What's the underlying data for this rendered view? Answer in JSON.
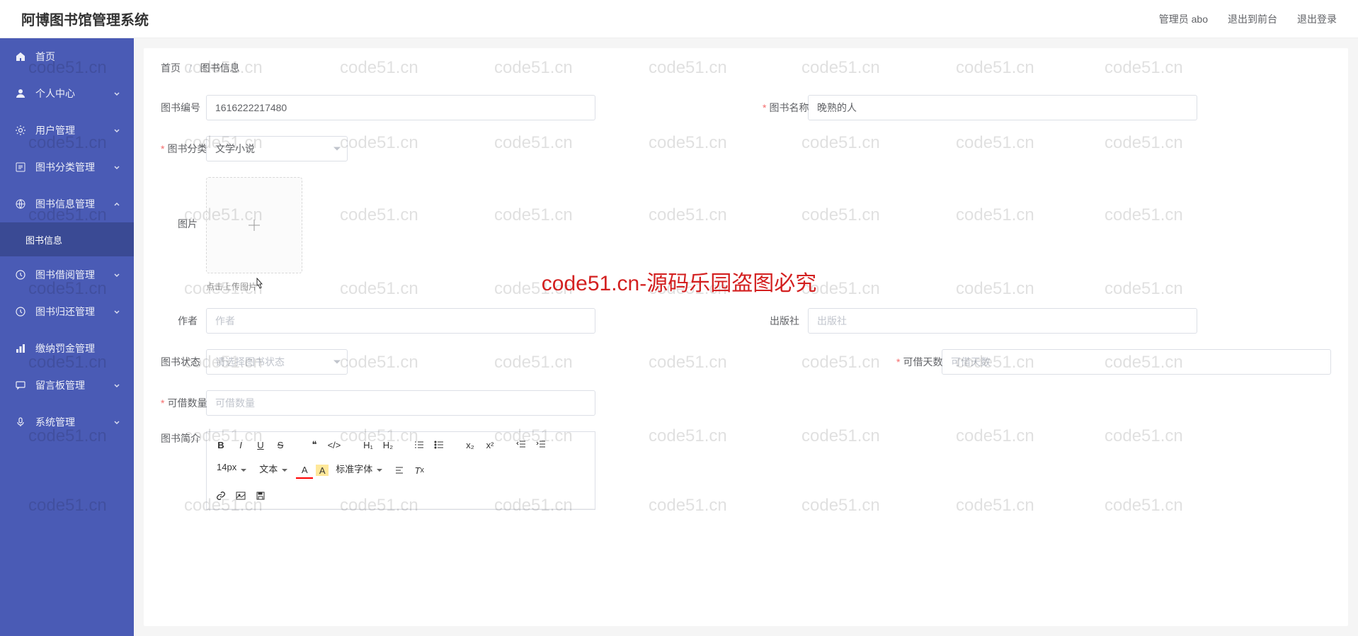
{
  "header": {
    "logo": "阿博图书馆管理系统",
    "admin": "管理员 abo",
    "exit_front": "退出到前台",
    "logout": "退出登录"
  },
  "sidebar": {
    "items": [
      {
        "label": "首页",
        "icon": "home"
      },
      {
        "label": "个人中心",
        "icon": "user",
        "arrow": true
      },
      {
        "label": "用户管理",
        "icon": "gear",
        "arrow": true
      },
      {
        "label": "图书分类管理",
        "icon": "list",
        "arrow": true
      },
      {
        "label": "图书信息管理",
        "icon": "globe",
        "arrow": true,
        "open": true,
        "sub": [
          {
            "label": "图书信息"
          }
        ]
      },
      {
        "label": "图书借阅管理",
        "icon": "clock",
        "arrow": true
      },
      {
        "label": "图书归还管理",
        "icon": "clock",
        "arrow": true
      },
      {
        "label": "缴纳罚金管理",
        "icon": "bar"
      },
      {
        "label": "留言板管理",
        "icon": "chat",
        "arrow": true
      },
      {
        "label": "系统管理",
        "icon": "mic",
        "arrow": true
      }
    ]
  },
  "breadcrumb": {
    "home": "首页",
    "current": "图书信息"
  },
  "form": {
    "book_id": {
      "label": "图书编号",
      "value": "1616222217480"
    },
    "book_name": {
      "label": "图书名称",
      "value": "晚熟的人"
    },
    "category": {
      "label": "图书分类",
      "value": "文学小说"
    },
    "image": {
      "label": "图片",
      "hint": "点击上传图片"
    },
    "author": {
      "label": "作者",
      "placeholder": "作者"
    },
    "publisher": {
      "label": "出版社",
      "placeholder": "出版社"
    },
    "status": {
      "label": "图书状态",
      "placeholder": "请选择图书状态"
    },
    "borrow_days": {
      "label": "可借天数",
      "placeholder": "可借天数"
    },
    "borrow_qty": {
      "label": "可借数量",
      "placeholder": "可借数量"
    },
    "intro": {
      "label": "图书简介"
    }
  },
  "editor": {
    "fontsize": "14px",
    "texttype": "文本",
    "fontfamily": "标准字体"
  },
  "watermark": {
    "repeat": "code51.cn",
    "center": "code51.cn-源码乐园盗图必究"
  }
}
